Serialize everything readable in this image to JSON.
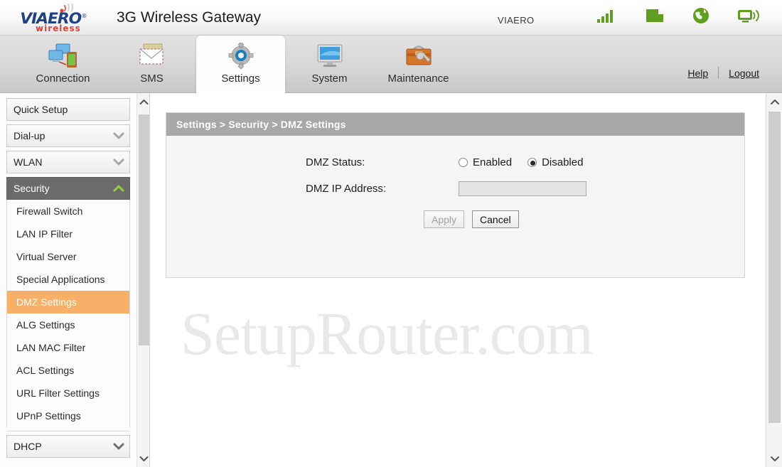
{
  "header": {
    "brand_name": "VIAERO",
    "brand_sub": "wireless",
    "title": "3G Wireless Gateway",
    "carrier": "VIAERO",
    "status_icons": [
      {
        "name": "signal-bars-icon",
        "color": "#5f9e1f"
      },
      {
        "name": "sim-card-icon",
        "color": "#5f9e1f"
      },
      {
        "name": "globe-icon",
        "color": "#5f9e1f"
      },
      {
        "name": "wireless-monitor-icon",
        "color": "#5f9e1f"
      }
    ],
    "help_label": "Help",
    "logout_label": "Logout"
  },
  "nav": {
    "tabs": [
      {
        "label": "Connection",
        "icon": "network-computers-icon",
        "active": false
      },
      {
        "label": "SMS",
        "icon": "envelope-icon",
        "active": false
      },
      {
        "label": "Settings",
        "icon": "gear-icon",
        "active": true
      },
      {
        "label": "System",
        "icon": "monitor-icon",
        "active": false
      },
      {
        "label": "Maintenance",
        "icon": "toolbox-wrench-icon",
        "active": false
      }
    ]
  },
  "sidebar": {
    "groups": [
      {
        "label": "Quick Setup",
        "state": "plain",
        "chevron": "none"
      },
      {
        "label": "Dial-up",
        "state": "collapsed",
        "chevron": "chevron-down-icon"
      },
      {
        "label": "WLAN",
        "state": "collapsed",
        "chevron": "chevron-down-icon"
      },
      {
        "label": "Security",
        "state": "expanded",
        "chevron": "chevron-up-icon"
      },
      {
        "label": "DHCP",
        "state": "collapsed",
        "chevron": "chevron-down-icon"
      }
    ],
    "security_items": [
      {
        "label": "Firewall Switch",
        "selected": false
      },
      {
        "label": "LAN IP Filter",
        "selected": false
      },
      {
        "label": "Virtual Server",
        "selected": false
      },
      {
        "label": "Special Applications",
        "selected": false
      },
      {
        "label": "DMZ Settings",
        "selected": true
      },
      {
        "label": "ALG Settings",
        "selected": false
      },
      {
        "label": "LAN MAC Filter",
        "selected": false
      },
      {
        "label": "ACL Settings",
        "selected": false
      },
      {
        "label": "URL Filter Settings",
        "selected": false
      },
      {
        "label": "UPnP Settings",
        "selected": false
      }
    ],
    "selected_color": "#f6b067",
    "expanded_color": "#6b6b6b"
  },
  "content": {
    "breadcrumb": "Settings > Security > DMZ Settings",
    "form": {
      "dmz_status_label": "DMZ Status:",
      "enabled_label": "Enabled",
      "disabled_label": "Disabled",
      "dmz_status_value": "Disabled",
      "dmz_ip_label": "DMZ IP Address:",
      "dmz_ip_value": "",
      "dmz_ip_placeholder": ""
    },
    "apply_label": "Apply",
    "apply_disabled": true,
    "cancel_label": "Cancel",
    "watermark": "SetupRouter.com"
  }
}
